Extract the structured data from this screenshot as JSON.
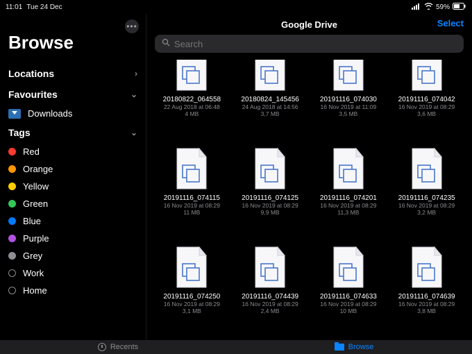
{
  "status": {
    "time": "11:01",
    "date": "Tue 24 Dec",
    "battery": "59%"
  },
  "sidebar": {
    "browse_title": "Browse",
    "sections": {
      "locations": "Locations",
      "favourites": "Favourites",
      "tags": "Tags"
    },
    "favourites": [
      {
        "label": "Downloads"
      }
    ],
    "tags": [
      {
        "label": "Red",
        "color": "#ff3b30",
        "open": false
      },
      {
        "label": "Orange",
        "color": "#ff9500",
        "open": false
      },
      {
        "label": "Yellow",
        "color": "#ffcc00",
        "open": false
      },
      {
        "label": "Green",
        "color": "#34c759",
        "open": false
      },
      {
        "label": "Blue",
        "color": "#007aff",
        "open": false
      },
      {
        "label": "Purple",
        "color": "#af52de",
        "open": false
      },
      {
        "label": "Grey",
        "color": "#8e8e93",
        "open": false
      },
      {
        "label": "Work",
        "color": null,
        "open": true
      },
      {
        "label": "Home",
        "color": null,
        "open": true
      }
    ]
  },
  "content": {
    "title": "Google Drive",
    "select_label": "Select",
    "search_placeholder": "Search",
    "files": [
      {
        "name": "20180822_064558",
        "date": "22 Aug 2018 at 06:48",
        "size": "4 MB",
        "clipped": true
      },
      {
        "name": "20180824_145456",
        "date": "24 Aug 2018 at 14:56",
        "size": "3,7 MB",
        "clipped": true
      },
      {
        "name": "20191116_074030",
        "date": "16 Nov 2019 at 11:09",
        "size": "3,5 MB",
        "clipped": true
      },
      {
        "name": "20191116_074042",
        "date": "16 Nov 2019 at 08:29",
        "size": "3,6 MB",
        "clipped": true
      },
      {
        "name": "20191116_074115",
        "date": "16 Nov 2019 at 08:29",
        "size": "11 MB",
        "clipped": false
      },
      {
        "name": "20191116_074125",
        "date": "16 Nov 2019 at 08:29",
        "size": "9,9 MB",
        "clipped": false
      },
      {
        "name": "20191116_074201",
        "date": "16 Nov 2019 at 08:29",
        "size": "11,3 MB",
        "clipped": false
      },
      {
        "name": "20191116_074235",
        "date": "16 Nov 2019 at 08:29",
        "size": "3,2 MB",
        "clipped": false
      },
      {
        "name": "20191116_074250",
        "date": "16 Nov 2019 at 08:29",
        "size": "3,1 MB",
        "clipped": false
      },
      {
        "name": "20191116_074439",
        "date": "16 Nov 2019 at 08:29",
        "size": "2,4 MB",
        "clipped": false
      },
      {
        "name": "20191116_074633",
        "date": "16 Nov 2019 at 08:29",
        "size": "10 MB",
        "clipped": false
      },
      {
        "name": "20191116_074639",
        "date": "16 Nov 2019 at 08:29",
        "size": "3,8 MB",
        "clipped": false
      }
    ]
  },
  "tabbar": {
    "recents": "Recents",
    "browse": "Browse"
  }
}
